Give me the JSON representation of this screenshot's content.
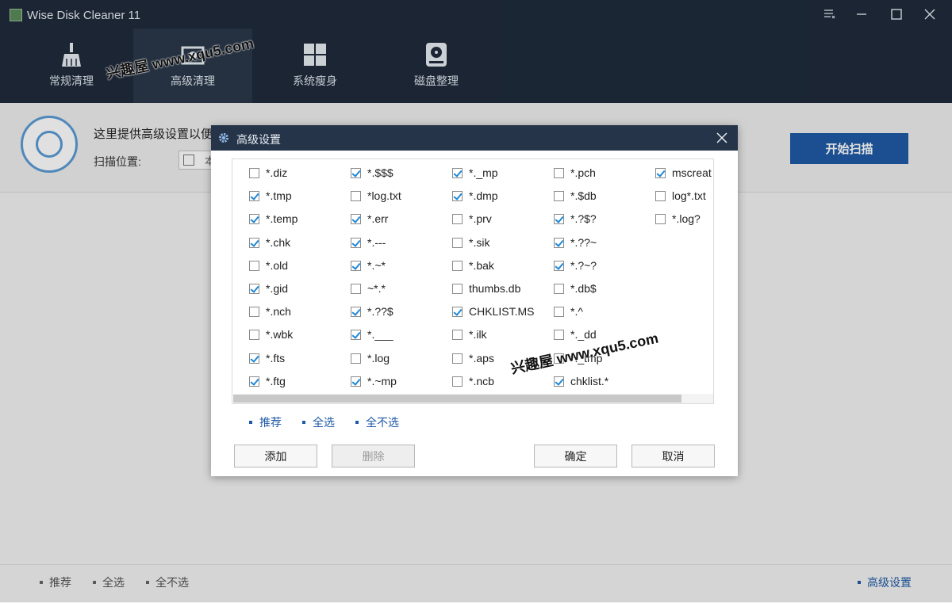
{
  "app": {
    "title": "Wise Disk Cleaner 11"
  },
  "tabs": [
    {
      "label": "常规清理",
      "icon": "broom-icon"
    },
    {
      "label": "高级清理",
      "icon": "advanced-clean-icon"
    },
    {
      "label": "系统瘦身",
      "icon": "windows-icon"
    },
    {
      "label": "磁盘整理",
      "icon": "disk-defrag-icon"
    }
  ],
  "header": {
    "description": "这里提供高级设置以便",
    "scan_location_label": "扫描位置:",
    "scan_location_value": "本",
    "start_button": "开始扫描"
  },
  "footer": {
    "recommend": "推荐",
    "select_all": "全选",
    "select_none": "全不选",
    "advanced_settings": "高级设置"
  },
  "dialog": {
    "title": "高级设置",
    "columns": [
      [
        {
          "label": "*.diz",
          "checked": false
        },
        {
          "label": "*.tmp",
          "checked": true
        },
        {
          "label": "*.temp",
          "checked": true
        },
        {
          "label": "*.chk",
          "checked": true
        },
        {
          "label": "*.old",
          "checked": false
        },
        {
          "label": "*.gid",
          "checked": true
        },
        {
          "label": "*.nch",
          "checked": false
        },
        {
          "label": "*.wbk",
          "checked": false
        },
        {
          "label": "*.fts",
          "checked": true
        },
        {
          "label": "*.ftg",
          "checked": true
        }
      ],
      [
        {
          "label": "*.$$$",
          "checked": true
        },
        {
          "label": "*log.txt",
          "checked": false
        },
        {
          "label": "*.err",
          "checked": true
        },
        {
          "label": "*.---",
          "checked": true
        },
        {
          "label": "*.~*",
          "checked": true
        },
        {
          "label": "~*.*",
          "checked": false
        },
        {
          "label": "*.??$",
          "checked": true
        },
        {
          "label": "*.___",
          "checked": true
        },
        {
          "label": "*.log",
          "checked": false
        },
        {
          "label": "*.~mp",
          "checked": true
        }
      ],
      [
        {
          "label": "*._mp",
          "checked": true
        },
        {
          "label": "*.dmp",
          "checked": true
        },
        {
          "label": "*.prv",
          "checked": false
        },
        {
          "label": "*.sik",
          "checked": false
        },
        {
          "label": "*.bak",
          "checked": false
        },
        {
          "label": "thumbs.db",
          "checked": false
        },
        {
          "label": "CHKLIST.MS",
          "checked": true
        },
        {
          "label": "*.ilk",
          "checked": false
        },
        {
          "label": "*.aps",
          "checked": false
        },
        {
          "label": "*.ncb",
          "checked": false
        }
      ],
      [
        {
          "label": "*.pch",
          "checked": false
        },
        {
          "label": "*.$db",
          "checked": false
        },
        {
          "label": "*.?$?",
          "checked": true
        },
        {
          "label": "*.??~",
          "checked": true
        },
        {
          "label": "*.?~?",
          "checked": true
        },
        {
          "label": "*.db$",
          "checked": false
        },
        {
          "label": "*.^",
          "checked": false
        },
        {
          "label": "*._dd",
          "checked": false
        },
        {
          "label": "*._tmp",
          "checked": false
        },
        {
          "label": "chklist.*",
          "checked": true
        }
      ],
      [
        {
          "label": "mscreat",
          "checked": true
        },
        {
          "label": "log*.txt",
          "checked": false
        },
        {
          "label": "*.log?",
          "checked": false
        }
      ]
    ],
    "links": {
      "recommend": "推荐",
      "select_all": "全选",
      "select_none": "全不选"
    },
    "buttons": {
      "add": "添加",
      "delete": "删除",
      "ok": "确定",
      "cancel": "取消"
    }
  },
  "watermark": "兴趣屋 www.xqu5.com",
  "colors": {
    "titlebar": "#1f2b3c",
    "accent": "#1f5aa6",
    "checkmark": "#1f88d6"
  }
}
